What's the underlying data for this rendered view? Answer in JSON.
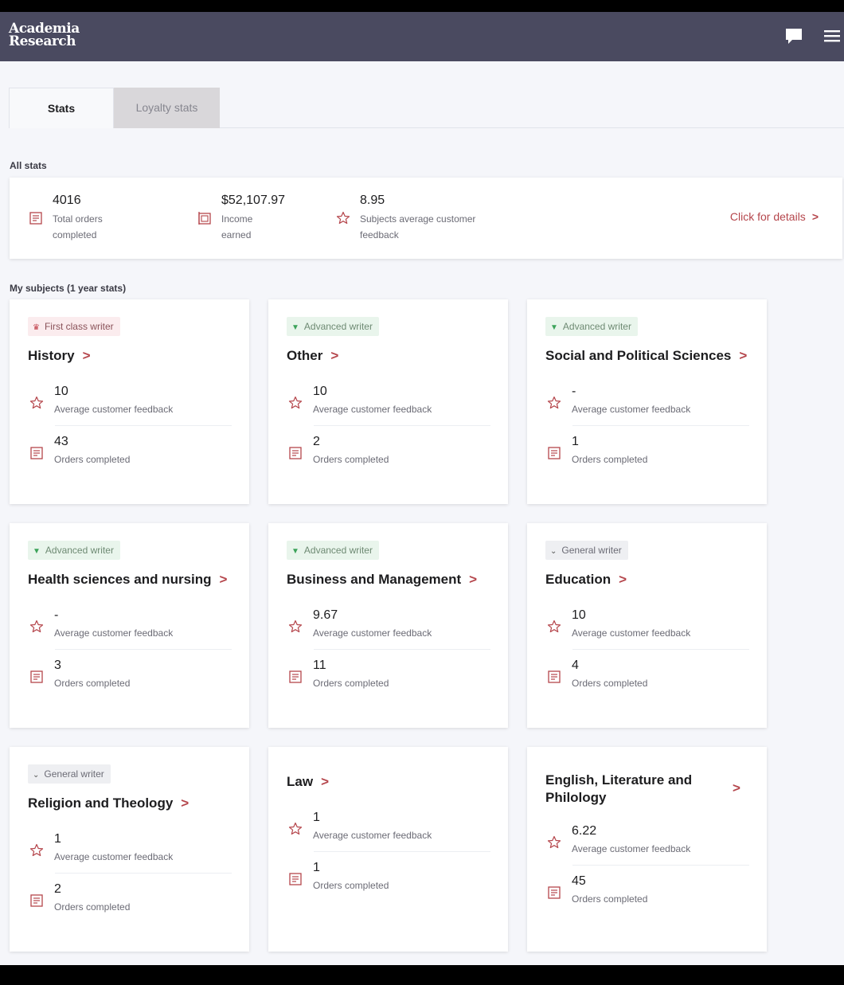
{
  "brand": {
    "line1": "Academia",
    "line2": "Research"
  },
  "header": {
    "chat_icon": "chat-bubble-icon",
    "menu_icon": "hamburger-menu-icon"
  },
  "tabs": [
    {
      "label": "Stats",
      "active": true
    },
    {
      "label": "Loyalty stats",
      "active": false
    }
  ],
  "all_stats": {
    "section_label": "All stats",
    "items": [
      {
        "value": "4016",
        "label": "Total orders completed",
        "icon": "orders-icon"
      },
      {
        "value": "$52,107.97",
        "label": "Income earned",
        "icon": "income-icon"
      },
      {
        "value": "8.95",
        "label": "Subjects average customer feedback",
        "icon": "star-icon"
      }
    ],
    "details_link": "Click for details"
  },
  "subjects_label": "My subjects (1 year stats)",
  "subjects": [
    {
      "badge": "First class writer",
      "badge_type": "first",
      "name": "History",
      "feedback": "10",
      "feedback_label": "Average customer feedback",
      "orders": "43",
      "orders_label": "Orders completed"
    },
    {
      "badge": "Advanced writer",
      "badge_type": "advanced",
      "name": "Other",
      "feedback": "10",
      "feedback_label": "Average customer feedback",
      "orders": "2",
      "orders_label": "Orders completed"
    },
    {
      "badge": "Advanced writer",
      "badge_type": "advanced",
      "name": "Social and Political Sciences",
      "feedback": "-",
      "feedback_label": "Average customer feedback",
      "orders": "1",
      "orders_label": "Orders completed"
    },
    {
      "badge": "Advanced writer",
      "badge_type": "advanced",
      "name": "Health sciences and nursing",
      "feedback": "-",
      "feedback_label": "Average customer feedback",
      "orders": "3",
      "orders_label": "Orders completed"
    },
    {
      "badge": "Advanced writer",
      "badge_type": "advanced",
      "name": "Business and Management",
      "feedback": "9.67",
      "feedback_label": "Average customer feedback",
      "orders": "11",
      "orders_label": "Orders completed"
    },
    {
      "badge": "General writer",
      "badge_type": "general",
      "name": "Education",
      "feedback": "10",
      "feedback_label": "Average customer feedback",
      "orders": "4",
      "orders_label": "Orders completed"
    },
    {
      "badge": "General writer",
      "badge_type": "general",
      "name": "Religion and Theology",
      "feedback": "1",
      "feedback_label": "Average customer feedback",
      "orders": "2",
      "orders_label": "Orders completed"
    },
    {
      "badge": "",
      "badge_type": "none",
      "name": "Law",
      "feedback": "1",
      "feedback_label": "Average customer feedback",
      "orders": "1",
      "orders_label": "Orders completed"
    },
    {
      "badge": "",
      "badge_type": "none",
      "name": "English, Literature and Philology",
      "feedback": "6.22",
      "feedback_label": "Average customer feedback",
      "orders": "45",
      "orders_label": "Orders completed"
    }
  ],
  "colors": {
    "header_bg": "#4a4a60",
    "accent": "#b5464c",
    "page_bg": "#f5f6fa"
  }
}
